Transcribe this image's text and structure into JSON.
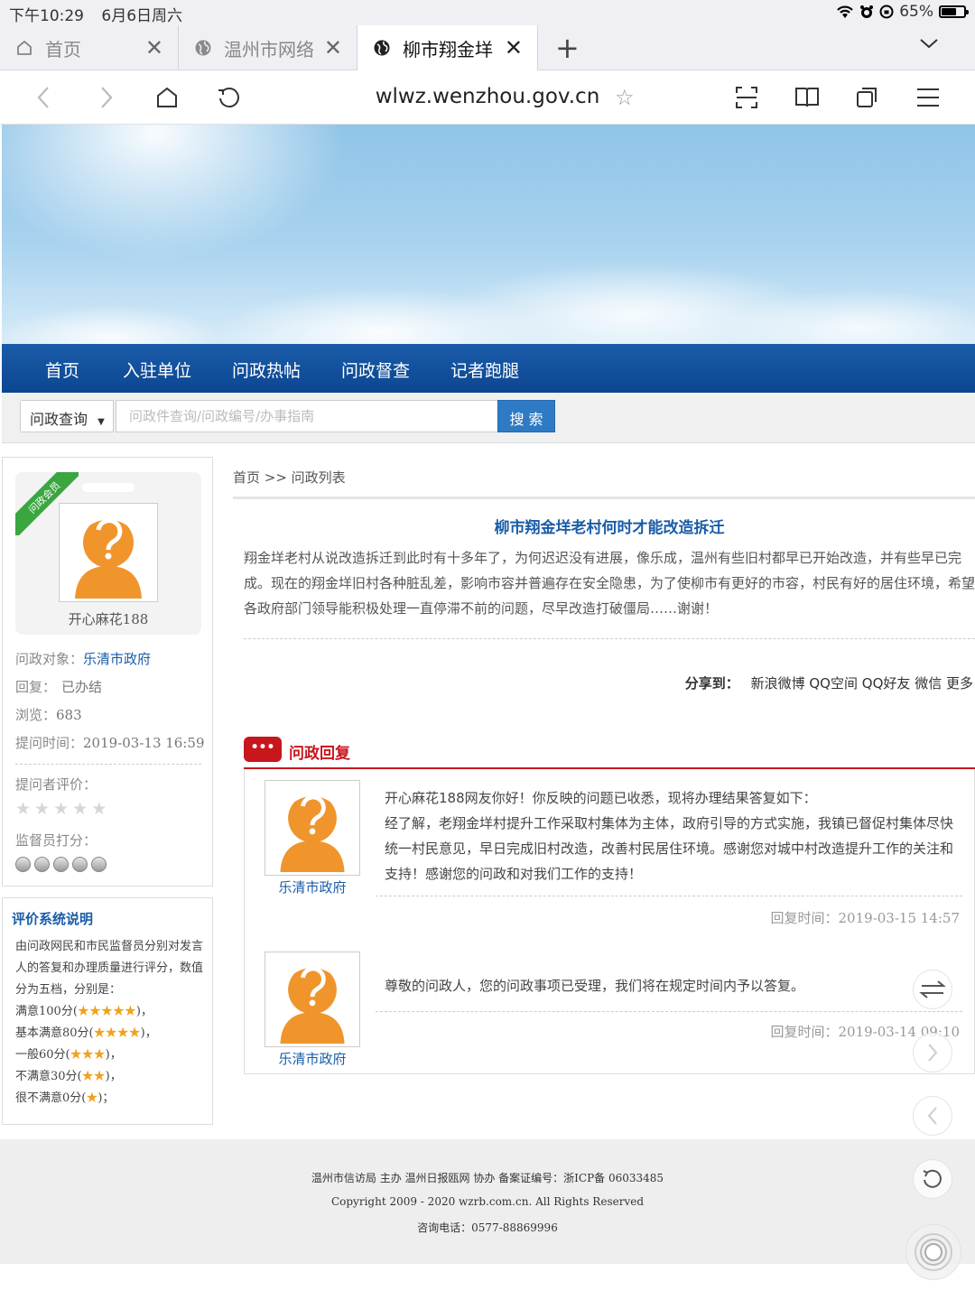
{
  "status_bar": {
    "time": "下午10:29",
    "date": "6月6日周六",
    "battery": "65%",
    "battery_level": 0.65
  },
  "tabs": [
    {
      "label": "首页"
    },
    {
      "label": "温州市网络"
    },
    {
      "label": "柳市翔金垟"
    }
  ],
  "address_bar": {
    "url": "wlwz.wenzhou.gov.cn"
  },
  "main_nav": [
    "首页",
    "入驻单位",
    "问政热帖",
    "问政督查",
    "记者跑腿"
  ],
  "search": {
    "select_value": "问政查询",
    "placeholder": "问政件查询/问政编号/办事指南",
    "button": "搜 索"
  },
  "user": {
    "badge": "问政会员",
    "name": "开心麻花188",
    "target_label": "问政对象：",
    "target_value": "乐清市政府",
    "reply_label": "回复：",
    "reply_value": "已办结",
    "views_label": "浏览：",
    "views_value": "683",
    "time_label": "提问时间：",
    "time_value": "2019-03-13 16:59",
    "rating_label": "提问者评价：",
    "score_label": "监督员打分："
  },
  "rules": {
    "title": "评价系统说明",
    "intro": "由问政网民和市民监督员分别对发言人的答复和办理质量进行评分，数值分为五档，分别是：",
    "levels": [
      {
        "label": "满意100分(",
        "stars": "★★★★★",
        "end": ")，"
      },
      {
        "label": "基本满意80分(",
        "stars": "★★★★",
        "end": ")，"
      },
      {
        "label": "一般60分(",
        "stars": "★★★",
        "end": ")，"
      },
      {
        "label": "不满意30分(",
        "stars": "★★",
        "end": ")，"
      },
      {
        "label": "很不满意0分(",
        "stars": "★",
        "end": ")；"
      }
    ]
  },
  "breadcrumb": "首页 >> 问政列表",
  "post": {
    "title": "柳市翔金垟老村何时才能改造拆迁",
    "body": "翔金垟老村从说改造拆迁到此时有十多年了，为何迟迟没有进展，像乐成，温州有些旧村都早已开始改造，并有些早已完成。现在的翔金垟旧村各种脏乱差，影响市容并普遍存在安全隐患，为了使柳市有更好的市容，村民有好的居住环境，希望各政府部门领导能积极处理一直停滞不前的问题，尽早改造打破僵局……谢谢！"
  },
  "share": {
    "label": "分享到：",
    "items": [
      "新浪微博",
      "QQ空间",
      "QQ好友",
      "微信",
      "更多"
    ]
  },
  "reply_section": {
    "icon_text": "•••",
    "title": "问政回复",
    "replies": [
      {
        "org": "乐清市政府",
        "lines": [
          "开心麻花188网友你好！你反映的问题已收悉，现将办理结果答复如下：",
          "经了解，老翔金垟村提升工作采取村集体为主体，政府引导的方式实施，我镇已督促村集体尽快统一村民意见，早日完成旧村改造，改善村民居住环境。感谢您对城中村改造提升工作的关注和支持！感谢您的问政和对我们工作的支持！"
        ],
        "time": "回复时间：2019-03-15 14:57"
      },
      {
        "org": "乐清市政府",
        "lines": [
          "尊敬的问政人，您的问政事项已受理，我们将在规定时间内予以答复。"
        ],
        "time": "回复时间：2019-03-14 09:10"
      }
    ]
  },
  "footer": {
    "line1": "温州市信访局 主办 温州日报瓯网 协办 备案证编号：浙ICP备 06033485",
    "line2": "Copyright 2009 - 2020 wzrb.com.cn. All Rights Reserved",
    "line3": "咨询电话：0577-88869996"
  },
  "colors": {
    "nav_blue": "#0c4691",
    "link_blue": "#1a5ca8",
    "reply_red": "#c8161d",
    "avatar_orange": "#f0952c",
    "star_orange": "#f2a21b"
  }
}
